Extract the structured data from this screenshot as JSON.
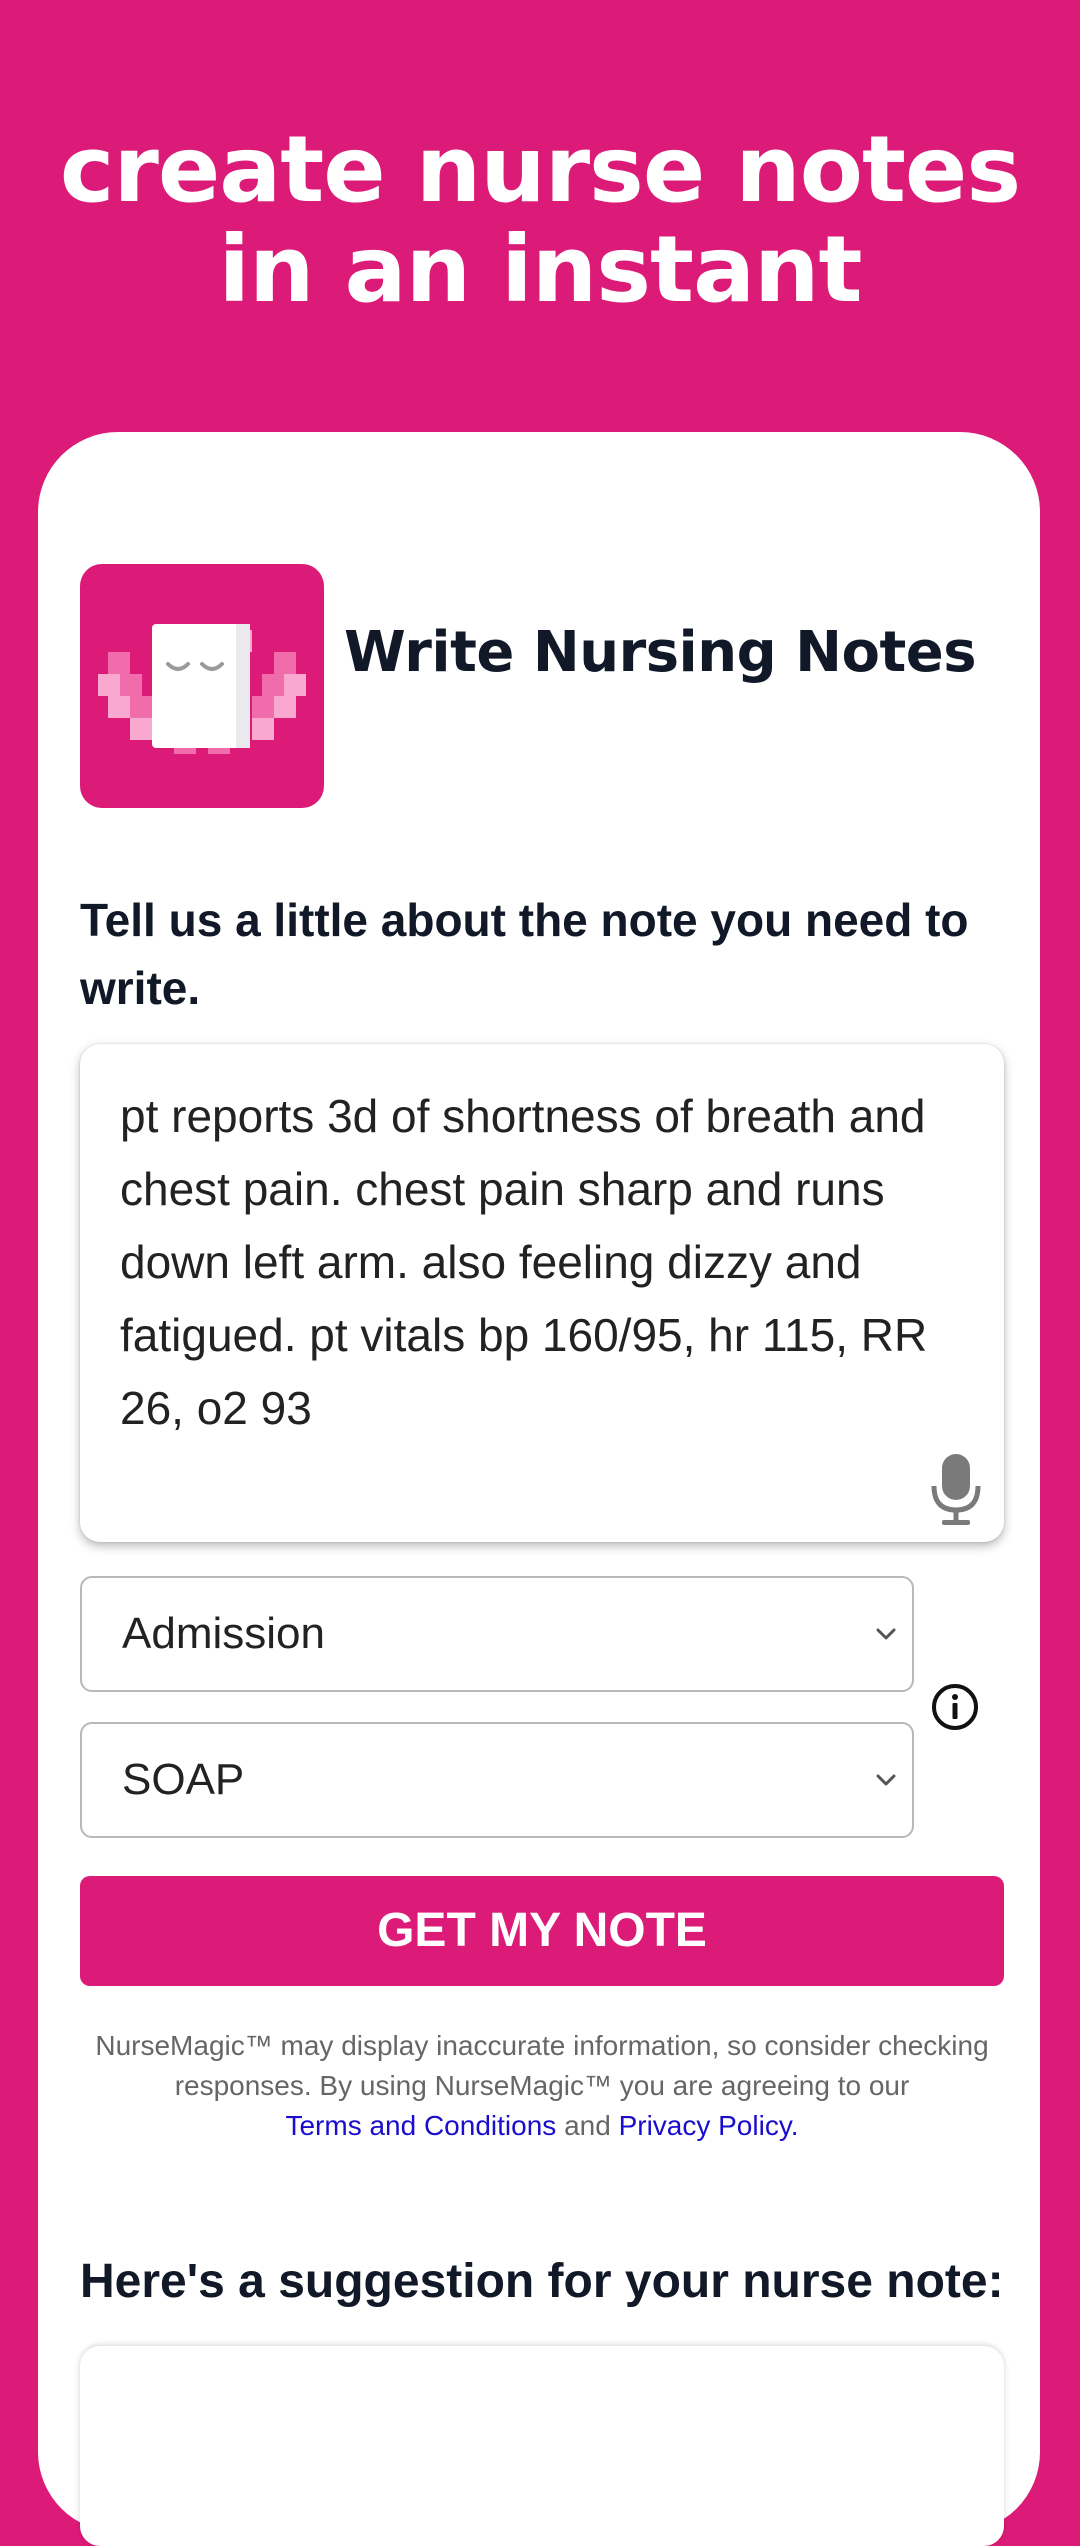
{
  "hero": {
    "line1": "create nurse notes",
    "line2": "in an instant"
  },
  "app": {
    "title": "Write Nursing Notes",
    "logo_icon": "notepad-smile-icon"
  },
  "form": {
    "prompt": "Tell us a little about the note you need to write.",
    "note_text": "pt reports 3d of shortness of breath and chest pain. chest pain sharp and runs down left arm. also feeling dizzy and fatigued. pt vitals bp 160/95, hr 115, RR 26, o2 93",
    "mic_icon": "microphone-icon",
    "note_type_selected": "Admission",
    "note_format_selected": "SOAP",
    "info_icon": "info-icon",
    "submit_label": "GET MY NOTE"
  },
  "disclaimer": {
    "text": "NurseMagic™ may display inaccurate information, so consider checking responses.  By using NurseMagic™ you are agreeing to our",
    "terms_link": "Terms and Conditions",
    "and": "and",
    "privacy_link": "Privacy Policy."
  },
  "suggestion": {
    "heading": "Here's a suggestion for your nurse note:"
  },
  "colors": {
    "brand": "#DC1B78",
    "link": "#1A0DCC",
    "text_dark": "#111827"
  }
}
